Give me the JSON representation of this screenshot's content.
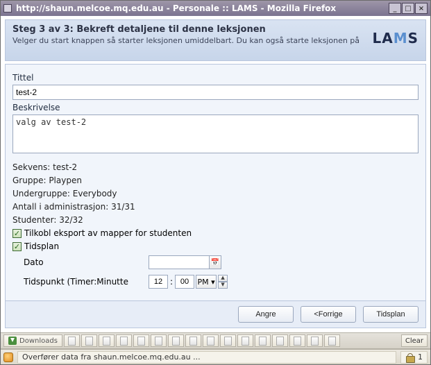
{
  "window": {
    "title": "http://shaun.melcoe.mq.edu.au - Personale :: LAMS - Mozilla Firefox"
  },
  "header": {
    "step_title": "Steg 3 av 3: Bekreft detaljene til denne leksjonen",
    "step_sub": "Velger du start knappen så starter leksjonen umiddelbart. Du kan også starte leksjonen på",
    "brand_pre": "LA",
    "brand_mid": "M",
    "brand_post": "S"
  },
  "form": {
    "title_label": "Tittel",
    "title_value": "test-2",
    "desc_label": "Beskrivelse",
    "desc_value": "valg av test-2",
    "sequence": "Sekvens: test-2",
    "group": "Gruppe: Playpen",
    "subgroup": "Undergruppe: Everybody",
    "admin_count": "Antall i administrasjon: 31/31",
    "students": "Studenter: 32/32",
    "chk_export": "Tilkobl eksport av mapper for studenten",
    "chk_schedule": "Tidsplan",
    "date_label": "Dato",
    "time_label": "Tidspunkt (Timer:Minutte",
    "hour": "12",
    "minute": "00",
    "ampm": "PM"
  },
  "buttons": {
    "undo": "Angre",
    "prev": "<Forrige",
    "schedule": "Tidsplan"
  },
  "tabs": {
    "downloads": "Downloads",
    "clear": "Clear"
  },
  "status": {
    "text": "Overfører data fra shaun.melcoe.mq.edu.au ...",
    "count": "1"
  }
}
